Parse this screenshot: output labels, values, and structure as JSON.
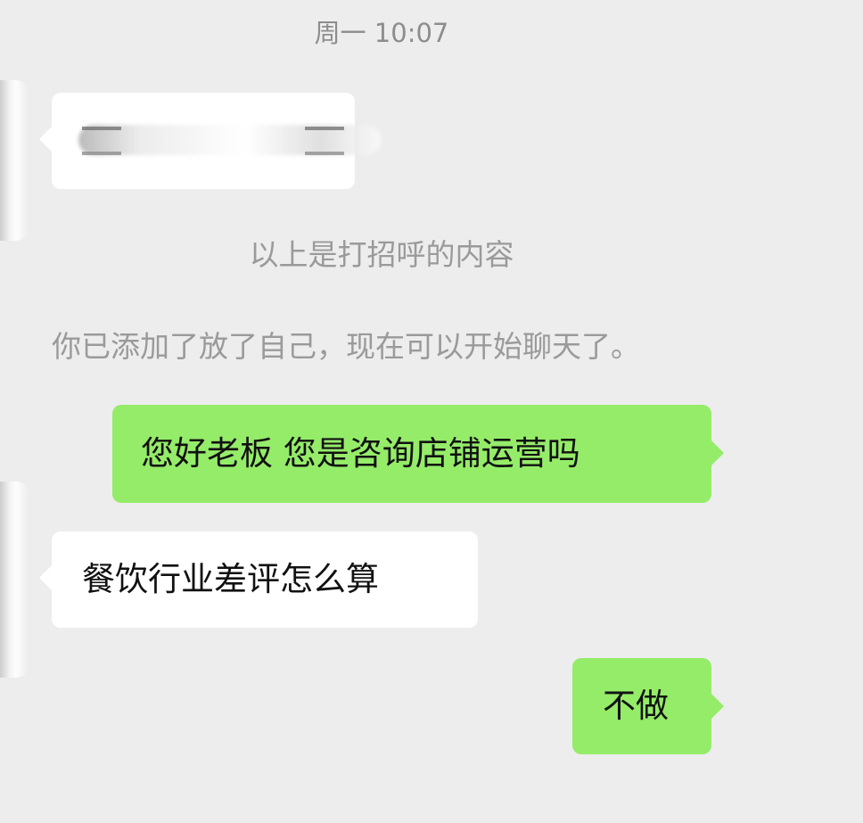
{
  "chat": {
    "timestamp": "周一 10:07",
    "system_greeting_notice": "以上是打招呼的内容",
    "system_added_notice": "你已添加了放了自己，现在可以开始聊天了。",
    "messages": [
      {
        "from": "contact",
        "text": ""
      },
      {
        "from": "me",
        "text": "您好老板 您是咨询店铺运营吗"
      },
      {
        "from": "contact",
        "text": "餐饮行业差评怎么算"
      },
      {
        "from": "me",
        "text": "不做"
      }
    ]
  },
  "colors": {
    "background": "#ededed",
    "incoming_bubble": "#ffffff",
    "outgoing_bubble": "#95ec69",
    "system_text": "#9a9a9a"
  },
  "icons": {
    "contact_avatar": "avatar-redacted-icon"
  }
}
